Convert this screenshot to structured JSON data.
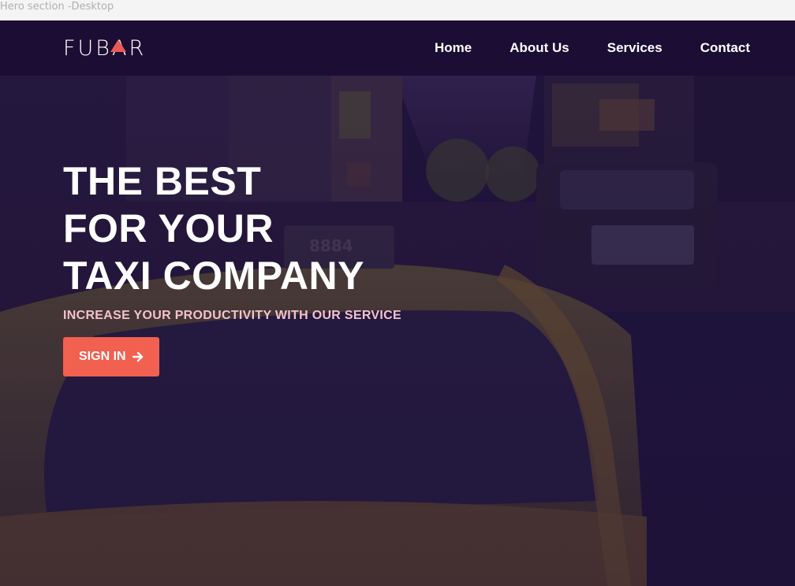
{
  "frame_label": "Hero section -Desktop",
  "brand": {
    "logo_text": "FUBAR",
    "accent": "#e85a56"
  },
  "nav": {
    "items": [
      {
        "label": "Home"
      },
      {
        "label": "About Us"
      },
      {
        "label": "Services"
      },
      {
        "label": "Contact"
      }
    ]
  },
  "hero": {
    "title_lines": [
      "THE BEST",
      "FOR YOUR",
      "TAXI COMPANY"
    ],
    "subtitle": "INCREASE YOUR PRODUCTIVITY WITH OUR SERVICE",
    "cta_label": "SIGN IN",
    "cta_icon": "arrow-right-icon"
  },
  "colors": {
    "nav_bg": "#1b0d33",
    "overlay": "#1e1140",
    "cta_bg": "#f2604f",
    "subtitle": "#f3c3c8",
    "taxi_yellow": "#d9a43a"
  }
}
